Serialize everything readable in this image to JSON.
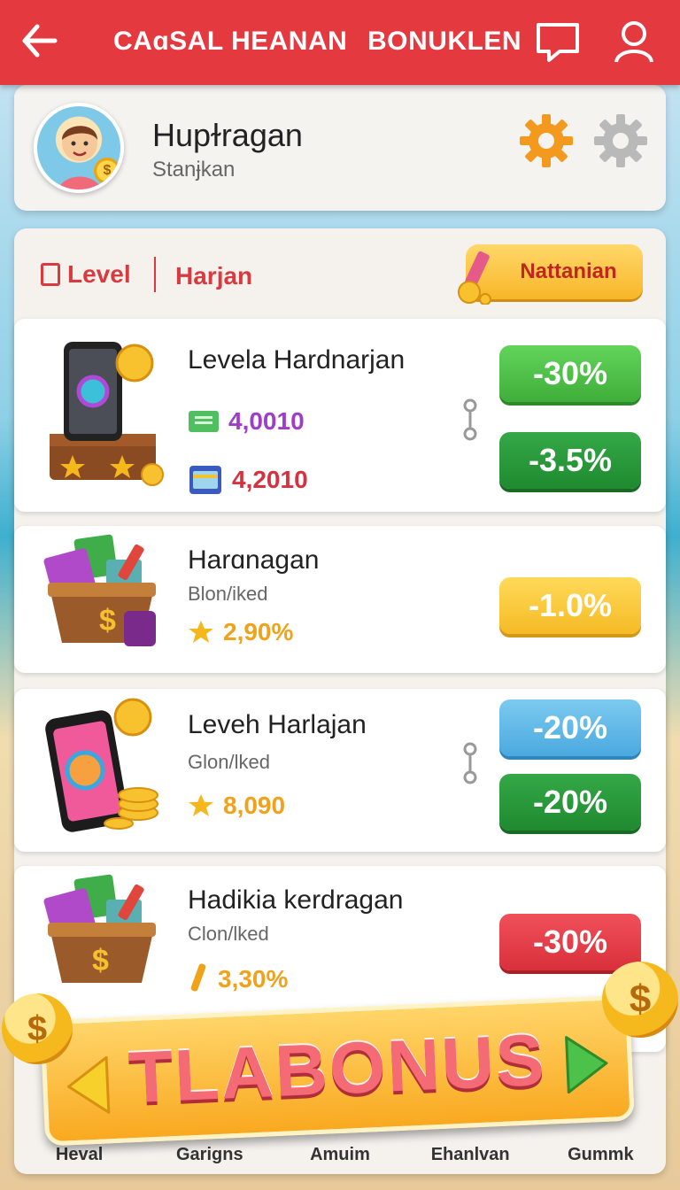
{
  "header": {
    "title": "CAɑSAL HEANAN",
    "bonus_link": "BONUKLEN",
    "icons": [
      "back-arrow-icon",
      "chat-icon",
      "user-icon"
    ]
  },
  "profile": {
    "name": "Hupɫragan",
    "subtitle": "Stanɉkan",
    "icons": [
      "settings-gear-icon"
    ]
  },
  "filters": {
    "level_label": "Level",
    "harjan_label": "Harjan",
    "nattanian_button": "Nattanian"
  },
  "offers": [
    {
      "title": "Levela Hardnarjan",
      "stats": [
        {
          "value": "4,0010",
          "color": "#a03cc8",
          "icon": "cash-icon"
        },
        {
          "value": "4,2010",
          "color": "#d63140",
          "icon": "card-icon"
        }
      ],
      "discounts": [
        {
          "label": "-30%",
          "style": "green"
        },
        {
          "label": "-3.5%",
          "style": "dgreen"
        }
      ]
    },
    {
      "title": "Harɑnagan",
      "subtitle": "Blon/iked",
      "stat": {
        "value": "2,90%",
        "color": "#f0a31a",
        "icon": "star-icon"
      },
      "discounts": [
        {
          "label": "-1.0%",
          "style": "yellow"
        }
      ]
    },
    {
      "title": "Leveh Harlajan",
      "subtitle": "Glon/lked",
      "stat": {
        "value": "8,090",
        "color": "#f0a31a",
        "icon": "star-icon"
      },
      "discounts": [
        {
          "label": "-20%",
          "style": "blue"
        },
        {
          "label": "-20%",
          "style": "dgreen"
        }
      ]
    },
    {
      "title": "Hadikia kerdragan",
      "subtitle": "Clon/lked",
      "stat": {
        "value": "3,30%",
        "color": "#f0a31a",
        "icon": "pencil-icon"
      },
      "discounts": [
        {
          "label": "-30%",
          "style": "red"
        }
      ]
    }
  ],
  "banner": {
    "text": "TLABONUS"
  },
  "bottom_nav": [
    {
      "label": "Heval"
    },
    {
      "label": "Garigns"
    },
    {
      "label": "Amuim"
    },
    {
      "label": "Ehanlvan"
    },
    {
      "label": "Gummk"
    }
  ]
}
